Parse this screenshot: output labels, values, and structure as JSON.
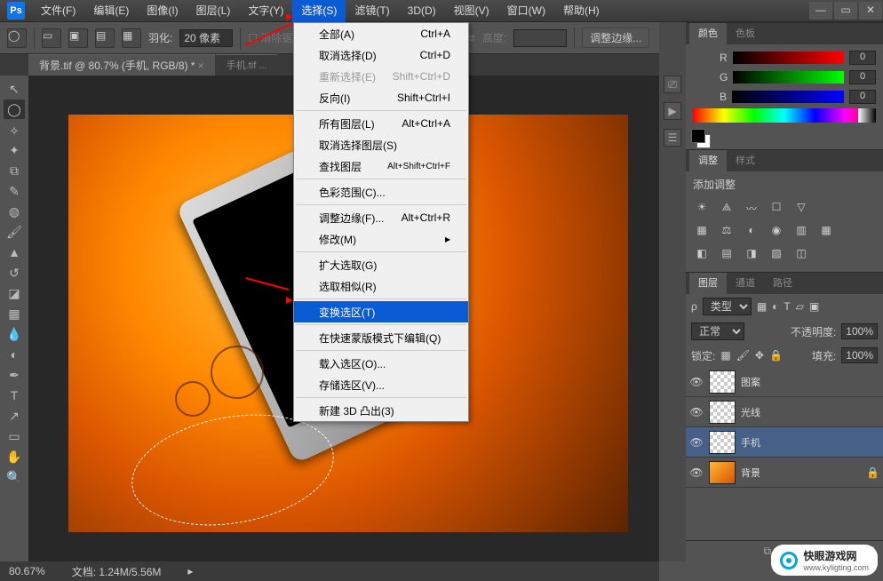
{
  "menubar": {
    "items": [
      "文件(F)",
      "编辑(E)",
      "图像(I)",
      "图层(L)",
      "文字(Y)",
      "选择(S)",
      "滤镜(T)",
      "3D(D)",
      "视图(V)",
      "窗口(W)",
      "帮助(H)"
    ],
    "open_index": 5
  },
  "optionbar": {
    "feather_label": "羽化:",
    "feather_value": "20 像素",
    "height_label": "高度:",
    "refine_edge": "调整边缘..."
  },
  "doctabs": {
    "active": "背景.tif @ 80.7% (手机, RGB/8) *",
    "inactive": "手机.tif ..."
  },
  "dropdown": [
    {
      "label": "全部(A)",
      "shortcut": "Ctrl+A"
    },
    {
      "label": "取消选择(D)",
      "shortcut": "Ctrl+D"
    },
    {
      "label": "重新选择(E)",
      "shortcut": "Shift+Ctrl+D",
      "disabled": true
    },
    {
      "label": "反向(I)",
      "shortcut": "Shift+Ctrl+I"
    },
    {
      "sep": true
    },
    {
      "label": "所有图层(L)",
      "shortcut": "Alt+Ctrl+A"
    },
    {
      "label": "取消选择图层(S)",
      "shortcut": ""
    },
    {
      "label": "查找图层",
      "shortcut": "Alt+Shift+Ctrl+F"
    },
    {
      "sep": true
    },
    {
      "label": "色彩范围(C)...",
      "shortcut": ""
    },
    {
      "sep": true
    },
    {
      "label": "调整边缘(F)...",
      "shortcut": "Alt+Ctrl+R"
    },
    {
      "label": "修改(M)",
      "shortcut": "",
      "sub": true
    },
    {
      "sep": true
    },
    {
      "label": "扩大选取(G)",
      "shortcut": ""
    },
    {
      "label": "选取相似(R)",
      "shortcut": ""
    },
    {
      "sep": true
    },
    {
      "label": "变换选区(T)",
      "shortcut": "",
      "hl": true
    },
    {
      "sep": true
    },
    {
      "label": "在快速蒙版模式下编辑(Q)",
      "shortcut": ""
    },
    {
      "sep": true
    },
    {
      "label": "载入选区(O)...",
      "shortcut": ""
    },
    {
      "label": "存储选区(V)...",
      "shortcut": ""
    },
    {
      "sep": true
    },
    {
      "label": "新建 3D 凸出(3)",
      "shortcut": ""
    }
  ],
  "color_panel": {
    "tabs": [
      "颜色",
      "色板"
    ],
    "r": {
      "label": "R",
      "value": "0"
    },
    "g": {
      "label": "G",
      "value": "0"
    },
    "b": {
      "label": "B",
      "value": "0"
    }
  },
  "adjust_panel": {
    "tabs": [
      "调整",
      "样式"
    ],
    "title": "添加调整"
  },
  "layers_panel": {
    "tabs": [
      "图层",
      "通道",
      "路径"
    ],
    "kind_label": "类型",
    "blend": "正常",
    "opacity_label": "不透明度:",
    "opacity_value": "100%",
    "lock_label": "锁定:",
    "fill_label": "填充:",
    "fill_value": "100%",
    "layers": [
      {
        "name": "图案",
        "thumb": "checker"
      },
      {
        "name": "光线",
        "thumb": "checker"
      },
      {
        "name": "手机",
        "thumb": "checker",
        "sel": true
      },
      {
        "name": "背景",
        "thumb": "img",
        "locked": true
      }
    ]
  },
  "statusbar": {
    "zoom": "80.67%",
    "doc": "文档: 1.24M/5.56M"
  },
  "watermark": {
    "title": "快眼游戏网",
    "url": "www.kyligting.com"
  }
}
